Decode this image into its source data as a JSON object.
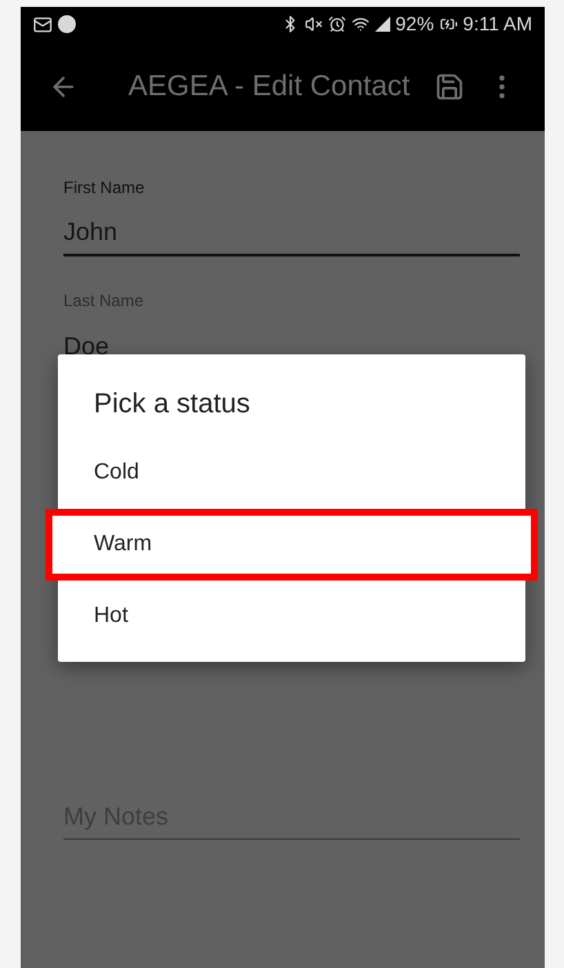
{
  "status_bar": {
    "battery": "92%",
    "time": "9:11 AM"
  },
  "app_bar": {
    "title": "AEGEA - Edit Contact"
  },
  "fields": [
    {
      "label": "First Name",
      "value": "John",
      "focused": true
    },
    {
      "label": "Last Name",
      "value": "Doe",
      "focused": false
    },
    {
      "placeholder": "My Notes"
    }
  ],
  "dialog": {
    "title": "Pick a status",
    "options": [
      {
        "label": "Cold",
        "highlighted": false
      },
      {
        "label": "Warm",
        "highlighted": true
      },
      {
        "label": "Hot",
        "highlighted": false
      }
    ]
  }
}
